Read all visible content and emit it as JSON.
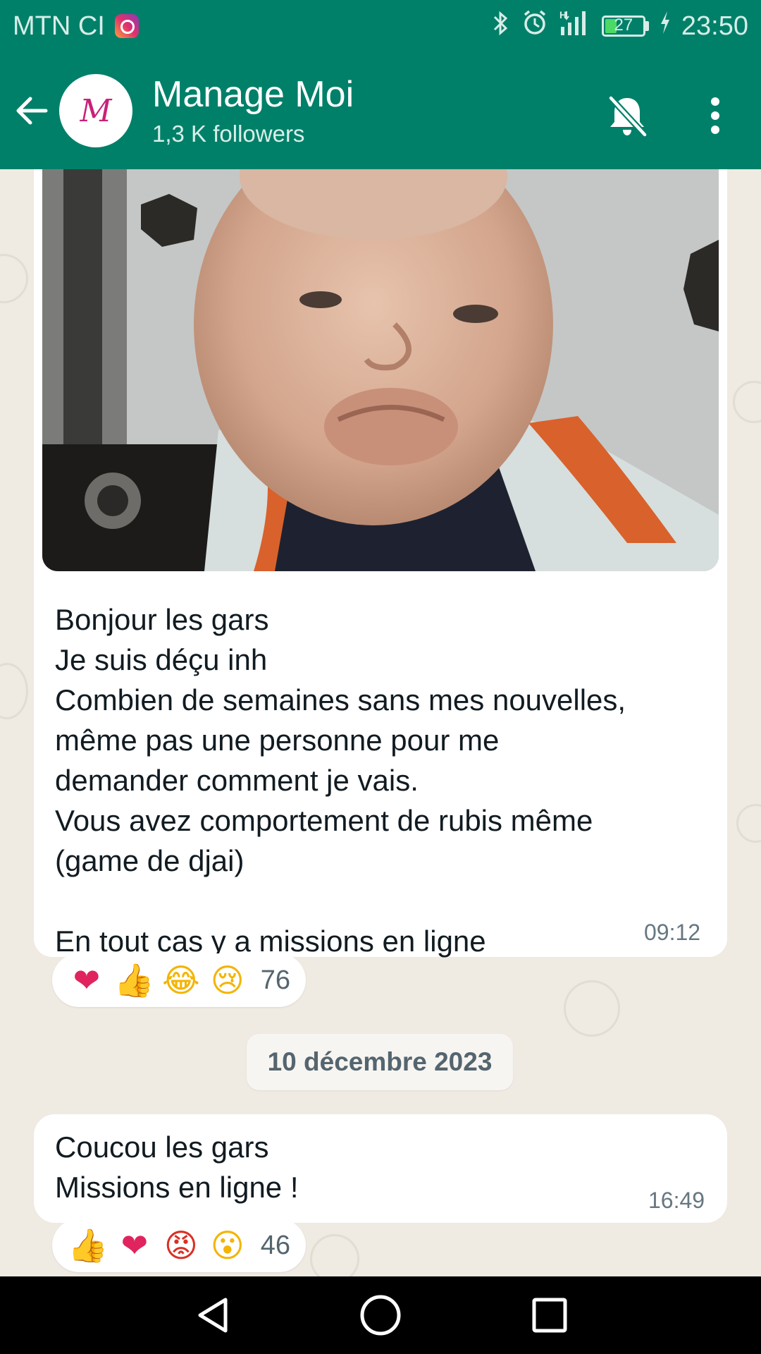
{
  "status_bar": {
    "carrier": "MTN CI",
    "battery_level": "27",
    "time": "23:50",
    "icons": [
      "instagram-icon",
      "bluetooth-icon",
      "alarm-icon",
      "signal-icon",
      "battery-icon",
      "charging-icon"
    ]
  },
  "header": {
    "channel_name": "Manage Moi",
    "followers": "1,3 K followers",
    "avatar_letter": "M",
    "icons": [
      "back-arrow-icon",
      "bell-off-icon",
      "more-vertical-icon"
    ]
  },
  "messages": [
    {
      "has_image": true,
      "text": "Bonjour les gars\nJe suis déçu inh\nCombien de semaines sans mes nouvelles,\nmême pas une personne pour me\ndemander comment je vais.\nVous avez comportement de rubis même\n(game de djai)\n\nEn tout cas y a missions en ligne",
      "time": "09:12",
      "reactions": [
        "❤",
        "👍",
        "😂",
        "😢"
      ],
      "reaction_count": "76"
    },
    {
      "text": "Coucou les gars\nMissions en ligne !",
      "time": "16:49",
      "reactions": [
        "👍",
        "❤",
        "😡",
        "😮"
      ],
      "reaction_count": "46"
    }
  ],
  "date_separator": "10 décembre 2023",
  "colors": {
    "header": "#008069",
    "chat_background": "#efeae2",
    "bubble": "#ffffff",
    "heart": "#e0245e",
    "thumbs": "#f4b400"
  }
}
